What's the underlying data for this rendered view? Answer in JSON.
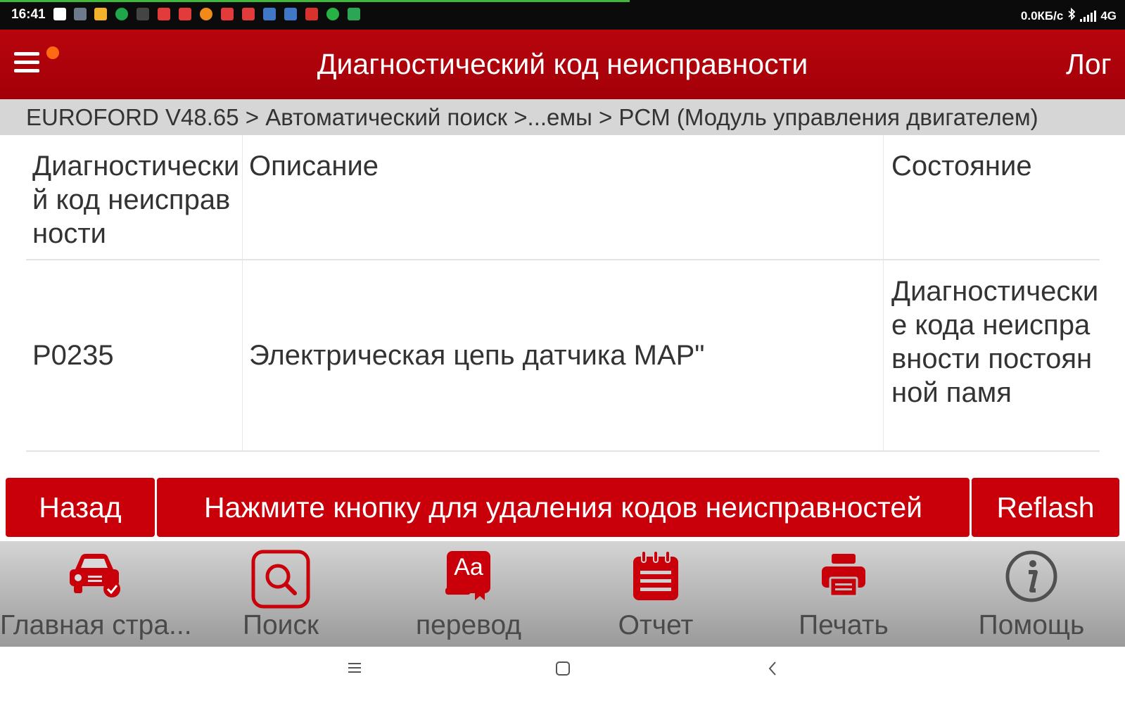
{
  "status_bar": {
    "time": "16:41",
    "network_speed": "0.0КБ/с",
    "network_type": "4G",
    "progress_color": "#3fb83a"
  },
  "header": {
    "title": "Диагностический код неисправности",
    "login_label": "Лог",
    "background_color": "#b10009"
  },
  "breadcrumb": "EUROFORD V48.65 > Автоматический поиск >...емы > PCM (Модуль управления двигателем)",
  "table": {
    "columns": [
      "Диагностический код неисправности",
      "Описание",
      "Состояние"
    ],
    "rows": [
      {
        "code": "P0235",
        "description": "Электрическая цепь датчика MAP\"",
        "status": "Диагностические кода неисправности постоянной памя"
      }
    ]
  },
  "actions": {
    "back": "Назад",
    "clear_codes": "Нажмите кнопку для удаления кодов неисправностей",
    "reflash": "Reflash"
  },
  "toolbar": {
    "home": "Главная стра...",
    "search": "Поиск",
    "translate": "перевод",
    "report": "Отчет",
    "print": "Печать",
    "help": "Помощь",
    "translate_icon_text": "Aa"
  },
  "accent_color": "#c90009"
}
